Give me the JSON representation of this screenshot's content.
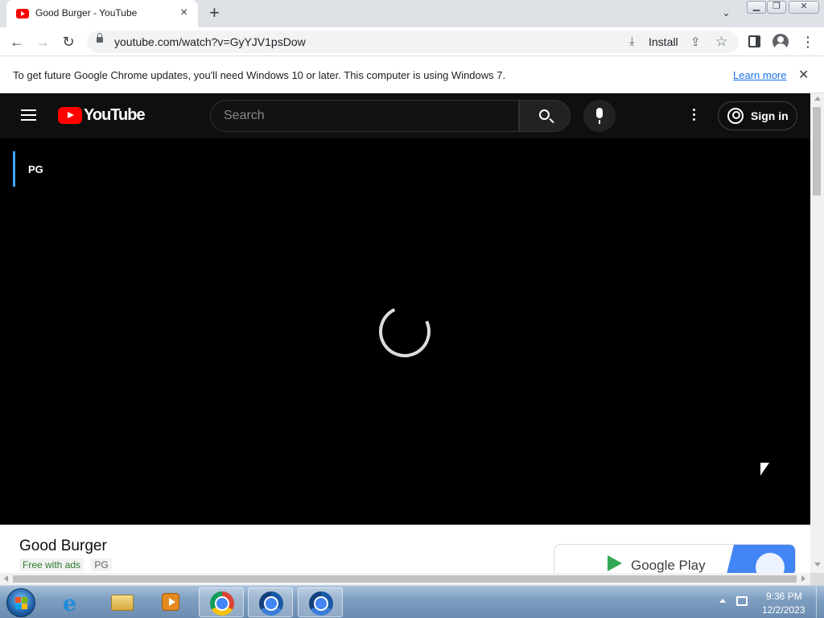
{
  "browser": {
    "tab": {
      "title": "Good Burger - YouTube",
      "favicon": "youtube-icon",
      "close": "×"
    },
    "new_tab": "+",
    "url": "youtube.com/watch?v=GyYJV1psDow",
    "install_label": "Install",
    "accent": "#1a73e8"
  },
  "infobar": {
    "message": "To get future Google Chrome updates, you'll need Windows 10 or later. This computer is using Windows 7.",
    "link": "Learn more",
    "close": "✕"
  },
  "youtube": {
    "logo_text": "YouTube",
    "search_placeholder": "Search",
    "sign_in": "Sign in",
    "rating": "PG",
    "video": {
      "title": "Good Burger",
      "badge_free": "Free with ads",
      "badge_rating": "PG"
    },
    "ad": {
      "label": "Google Play"
    },
    "brand_color": "#ff0000"
  },
  "taskbar": {
    "time": "9:36 PM",
    "date": "12/2/2023"
  }
}
